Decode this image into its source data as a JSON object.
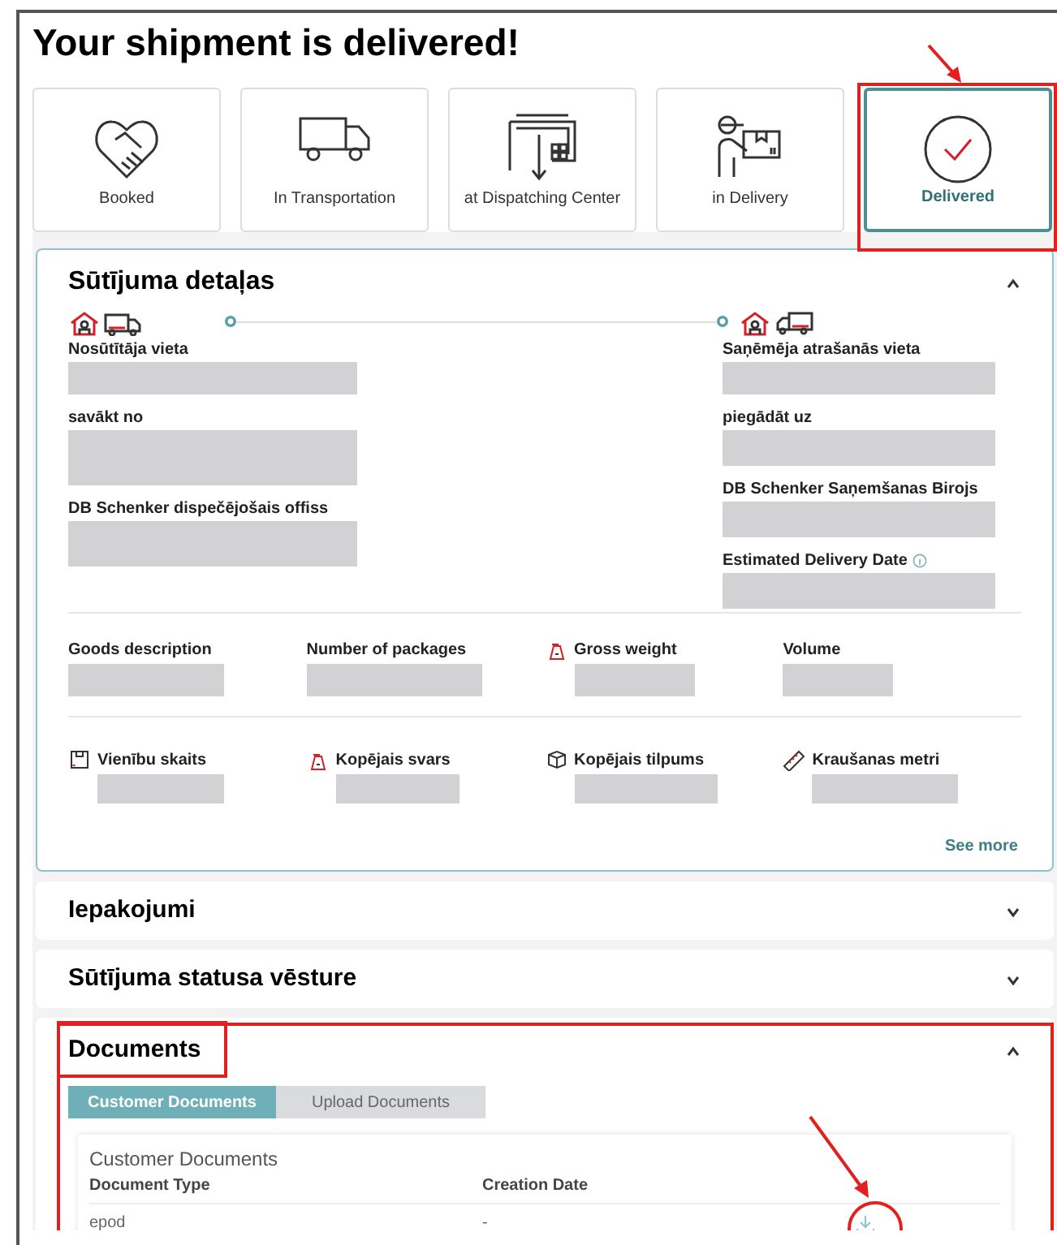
{
  "title": "Your shipment is delivered!",
  "steps": [
    {
      "label": "Booked",
      "kind": "handshake",
      "selected": false
    },
    {
      "label": "In Transportation",
      "kind": "truck",
      "selected": false
    },
    {
      "label": "at Dispatching Center",
      "kind": "warehouse",
      "selected": false
    },
    {
      "label": "in Delivery",
      "kind": "courier",
      "selected": false
    },
    {
      "label": "Delivered",
      "kind": "check",
      "selected": true
    }
  ],
  "details": {
    "title": "Sūtījuma detaļas",
    "expanded": true,
    "origin": [
      "Nosūtītāja vieta",
      "savākt no",
      "DB Schenker dispečējošais offiss"
    ],
    "destination": [
      {
        "label": "Saņēmēja atrašanās vieta",
        "info": false
      },
      {
        "label": "piegādāt uz",
        "info": false
      },
      {
        "label": "DB Schenker Saņemšanas Birojs",
        "info": false
      },
      {
        "label": "Estimated Delivery Date",
        "info": true
      }
    ],
    "facts": [
      {
        "label": "Goods description",
        "kind": "plain"
      },
      {
        "label": "Number of packages",
        "kind": "plain"
      },
      {
        "label": "Gross weight",
        "kind": "weight"
      },
      {
        "label": "Volume",
        "kind": "plain"
      },
      {
        "label": "Vienību skaits",
        "kind": "box"
      },
      {
        "label": "Kopējais svars",
        "kind": "weight"
      },
      {
        "label": "Kopējais tilpums",
        "kind": "cube"
      },
      {
        "label": "Kraušanas metri",
        "kind": "ruler"
      }
    ],
    "see_more": "See more"
  },
  "sections": [
    {
      "title": "Iepakojumi",
      "expanded": false
    },
    {
      "title": "Sūtījuma statusa vēsture",
      "expanded": false
    }
  ],
  "documents": {
    "title": "Documents",
    "expanded": true,
    "tabs": [
      {
        "label": "Customer Documents",
        "selected": true
      },
      {
        "label": "Upload Documents",
        "selected": false
      }
    ],
    "table_title": "Customer Documents",
    "columns": [
      "Document Type",
      "Creation Date"
    ],
    "rows": [
      {
        "document_type": "epod",
        "creation_date": "-"
      }
    ]
  }
}
